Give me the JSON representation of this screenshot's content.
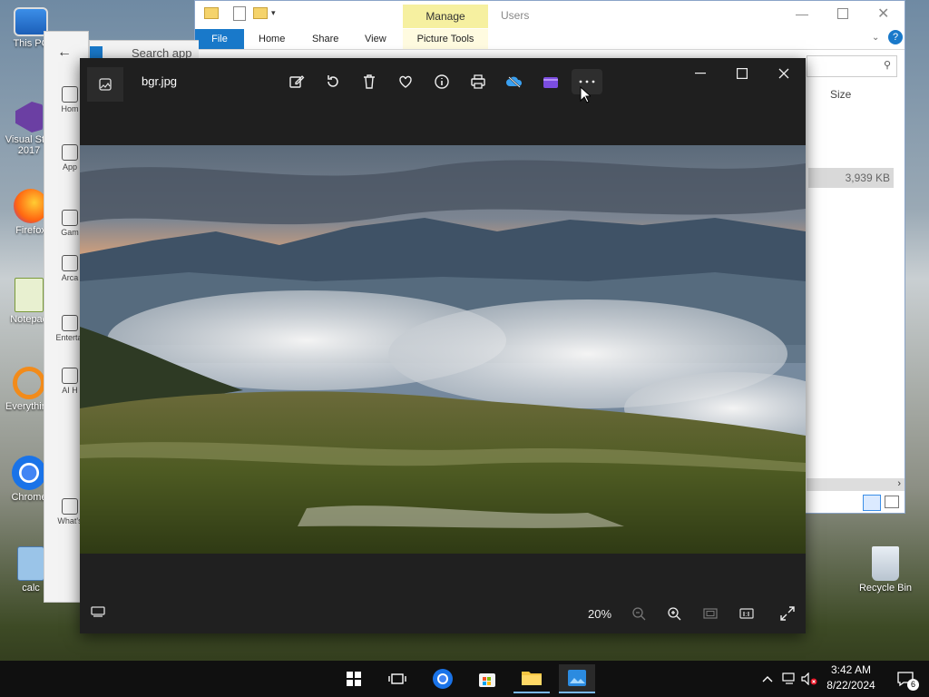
{
  "desktop": {
    "icons": [
      {
        "label": "This PC"
      },
      {
        "label": "Visual St..."
      },
      {
        "label": "2017"
      },
      {
        "label": "Firefox"
      },
      {
        "label": "Notepad"
      },
      {
        "label": "Everything"
      },
      {
        "label": "Chrome"
      },
      {
        "label": "calc"
      },
      {
        "label": "Recycle Bin"
      }
    ]
  },
  "explorer": {
    "manage_tab": "Manage",
    "users_label": "Users",
    "tabs": [
      "File",
      "Home",
      "Share",
      "View",
      "Picture Tools"
    ],
    "size_header": "Size",
    "file_size": "3,939 KB",
    "search_placeholder": "Search app"
  },
  "leftpanel": {
    "items": [
      "Hom",
      "App",
      "Gam",
      "Arca",
      "Entertai",
      "AI H",
      "What's"
    ]
  },
  "viewer": {
    "filename": "bgr.jpg",
    "zoom": "20%",
    "toolbar_icons": [
      "edit-icon",
      "rotate-icon",
      "delete-icon",
      "favorite-icon",
      "info-icon",
      "print-icon",
      "onedrive-icon",
      "clipchamp-icon",
      "more-icon"
    ]
  },
  "taskbar": {
    "time": "3:42 AM",
    "date": "8/22/2024",
    "notif_count": "6"
  }
}
